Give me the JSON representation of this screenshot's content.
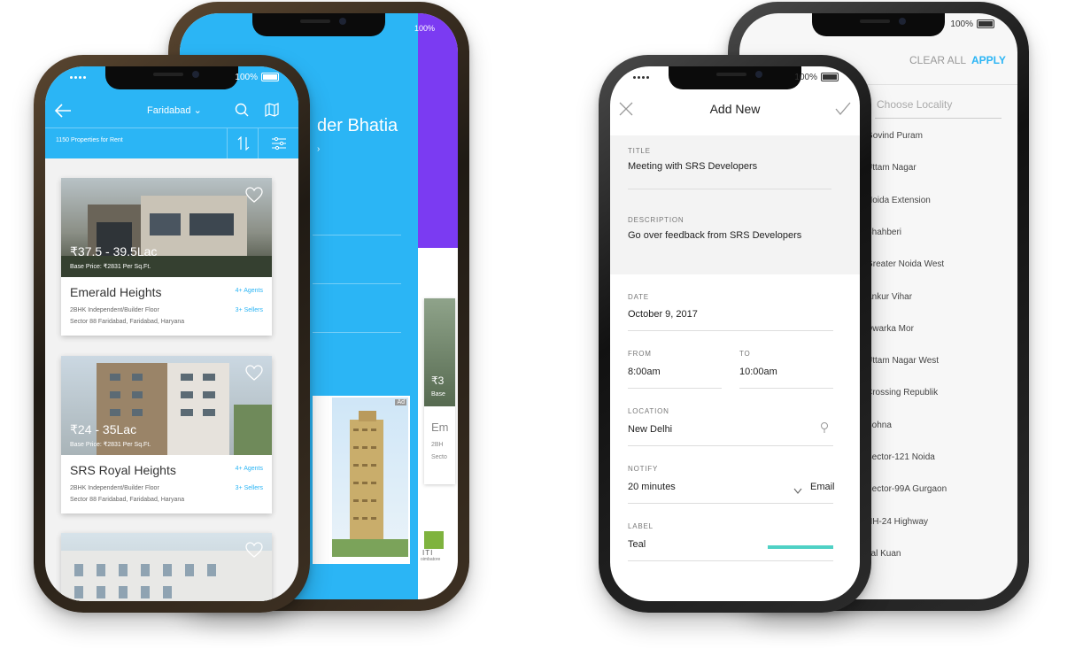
{
  "colors": {
    "accent": "#2bb5f5",
    "purple": "#7b3bf2",
    "teal": "#4fd1c5",
    "apply": "#2bb5f5"
  },
  "listing": {
    "status_battery": "100%",
    "city": "Faridabad",
    "count": "1150 Properties for Rent",
    "cards": [
      {
        "price": "₹37.5 - 39.5Lac",
        "base": "Base Price:  ₹2831 Per Sq.Ft.",
        "name": "Emerald Heights",
        "type": "2BHK Independent/Builder Floor",
        "addr": "Sector 88 Faridabad, Faridabad, Haryana",
        "agents": "4+ Agents",
        "sellers": "3+ Sellers"
      },
      {
        "price": "₹24 - 35Lac",
        "base": "Base Price:  ₹2831 Per Sq.Ft.",
        "name": "SRS Royal Heights",
        "type": "2BHK Independent/Builder Floor",
        "addr": "Sector 88 Faridabad, Faridabad, Haryana",
        "agents": "4+ Agents",
        "sellers": "3+ Sellers"
      }
    ]
  },
  "profile": {
    "status_battery": "100%",
    "name_partial": "der Bhatia",
    "price_partial": "₹3",
    "base_partial": "Base",
    "name2_partial": "Em",
    "line_partial": "2BH",
    "line2_partial": "Secto",
    "ad_badge": "Ad",
    "brand_partial": "ITI",
    "city_partial": "oimbatore"
  },
  "form": {
    "status_battery": "100%",
    "title": "Add New",
    "fields": {
      "title_label": "TITLE",
      "title_value": "Meeting with SRS Developers",
      "desc_label": "DESCRIPTION",
      "desc_value": "Go over feedback from SRS Developers",
      "date_label": "DATE",
      "date_value": "October 9, 2017",
      "from_label": "FROM",
      "from_value": "8:00am",
      "to_label": "TO",
      "to_value": "10:00am",
      "location_label": "LOCATION",
      "location_value": "New Delhi",
      "notify_label": "NOTIFY",
      "notify_value": "20 minutes",
      "notify_method": "Email",
      "label_label": "LABEL",
      "label_value": "Teal"
    }
  },
  "filter": {
    "status_battery": "100%",
    "clear_all": "CLEAR ALL",
    "apply": "APPLY",
    "search_placeholder": "Choose Locality",
    "localities": [
      "Govind Puram",
      "Uttam Nagar",
      "Noida Extension",
      "Shahberi",
      "Greater Noida West",
      "Ankur Vihar",
      "Dwarka Mor",
      "Uttam Nagar West",
      "Crossing Republik",
      "Sohna",
      "Sector-121 Noida",
      "Sector-99A Gurgaon",
      "NH-24 Highway",
      "Lal Kuan"
    ]
  }
}
